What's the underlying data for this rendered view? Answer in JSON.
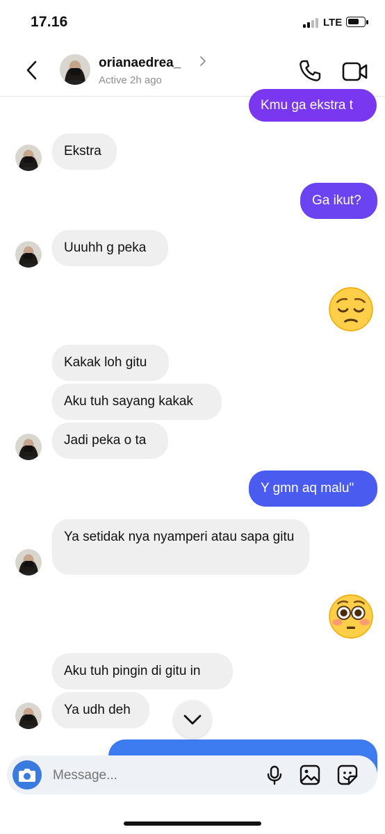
{
  "status_bar": {
    "time": "17.16",
    "network": "LTE"
  },
  "header": {
    "name": "orianaedrea_",
    "presence": "Active 2h ago"
  },
  "messages": [
    {
      "side": "out",
      "text": "Kmu ga ekstra t"
    },
    {
      "side": "in",
      "text": "Ekstra"
    },
    {
      "side": "out",
      "text": "Ga ikut?"
    },
    {
      "side": "in",
      "text": "Uuuhh g peka"
    },
    {
      "side": "out",
      "text": "😔"
    },
    {
      "side": "in",
      "text": "Kakak loh gitu"
    },
    {
      "side": "in",
      "text": "Aku tuh sayang kakak"
    },
    {
      "side": "in",
      "text": "Jadi peka o ta"
    },
    {
      "side": "out",
      "text": "Y gmn aq malu\""
    },
    {
      "side": "in",
      "text": "Ya setidak nya nyamperi atau sapa gitu"
    },
    {
      "side": "out",
      "text": "😳"
    },
    {
      "side": "in",
      "text": "Aku tuh pingin di gitu in"
    },
    {
      "side": "in",
      "text": "Ya udh deh"
    }
  ],
  "composer": {
    "placeholder": "Message..."
  },
  "colors": {
    "outgoing_top": "#7a37f0",
    "outgoing_bottom": "#3d6cf0",
    "incoming": "#efeff0",
    "accent_camera": "#3a7be0"
  },
  "icons": [
    "back-icon",
    "chevron-right-icon",
    "phone-icon",
    "video-camera-icon",
    "chevron-down-icon",
    "camera-icon",
    "microphone-icon",
    "gallery-icon",
    "sticker-icon"
  ]
}
